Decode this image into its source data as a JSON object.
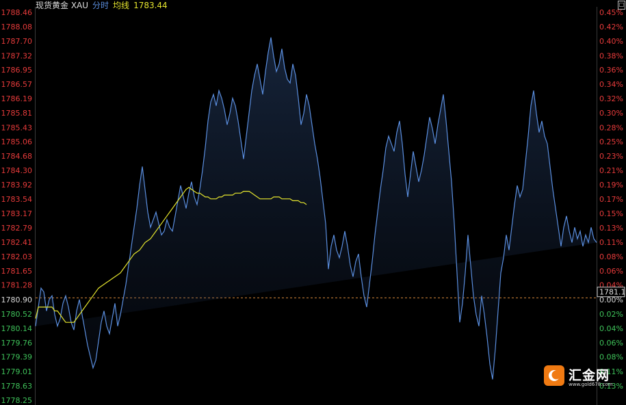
{
  "header": {
    "instrument": "现货黄金 XAU",
    "mode": "分时",
    "avg_label": "均线",
    "avg_value": "1783.44"
  },
  "corner_glyph": "□",
  "colors": {
    "background": "#000000",
    "price_line": "#5b8fe0",
    "average_line": "#e6e62e",
    "up_text": "#e83b3b",
    "down_text": "#3fc35a",
    "neutral_text": "#dddddd",
    "reference_line": "#d98a3c"
  },
  "logo": {
    "icon": "crescent-logo-icon",
    "name": "汇金网",
    "url_text": "www.gold678.com"
  },
  "chart_data": {
    "type": "line",
    "reference_price": 1780.9,
    "current_price_label": "1781.1",
    "ylim": [
      1778.25,
      1788.46
    ],
    "y_ticks": [
      "1788.46",
      "1788.08",
      "1787.70",
      "1787.32",
      "1786.95",
      "1786.57",
      "1786.19",
      "1785.81",
      "1785.43",
      "1785.06",
      "1784.68",
      "1784.30",
      "1783.92",
      "1783.54",
      "1783.17",
      "1782.79",
      "1782.41",
      "1782.03",
      "1781.65",
      "1781.28",
      "1780.90",
      "1780.52",
      "1780.14",
      "1779.76",
      "1779.39",
      "1779.01",
      "1778.63",
      "1778.25"
    ],
    "y2_ticks": [
      "0.45%",
      "0.42%",
      "0.40%",
      "0.38%",
      "0.36%",
      "0.34%",
      "0.32%",
      "0.30%",
      "0.28%",
      "0.25%",
      "0.23%",
      "0.21%",
      "0.19%",
      "0.17%",
      "0.15%",
      "0.13%",
      "0.11%",
      "0.08%",
      "0.06%",
      "0.04%",
      "0.00%",
      "0.02%",
      "0.04%",
      "0.06%",
      "0.08%",
      "0.11%",
      "0.13%"
    ],
    "x": [
      0,
      2,
      4,
      6,
      8,
      10,
      12,
      14,
      16,
      18,
      20,
      22,
      24,
      26,
      28,
      30,
      32,
      34,
      36,
      38,
      40,
      42,
      44,
      46,
      48,
      50,
      52,
      54,
      56,
      58,
      60,
      62,
      64,
      66,
      68,
      70,
      72,
      74,
      76,
      78,
      80,
      82,
      84,
      86,
      88,
      90,
      92,
      94,
      96,
      98,
      100,
      102,
      104,
      106,
      108,
      110,
      112,
      114,
      116,
      118,
      120,
      122,
      124,
      126,
      128,
      130,
      132,
      134,
      136,
      138,
      140,
      142,
      144,
      146,
      148,
      150,
      152,
      154,
      156,
      158,
      160,
      162,
      164,
      166,
      168,
      170,
      172,
      174,
      176,
      178,
      180,
      182,
      184,
      186,
      188,
      190,
      192,
      194,
      196,
      198,
      200,
      202,
      204,
      206,
      208,
      210,
      212,
      214,
      216,
      218,
      220,
      222,
      224,
      226,
      228,
      230,
      232,
      234,
      236,
      238,
      240,
      242,
      244,
      246,
      248,
      250,
      252,
      254,
      256,
      258,
      260,
      262,
      264,
      266,
      268,
      270,
      272,
      274,
      276,
      278,
      280,
      282,
      284,
      286,
      288,
      290,
      292,
      294,
      296,
      298,
      300,
      302,
      304,
      306,
      308,
      310,
      312,
      314,
      316,
      318,
      320,
      322,
      324,
      326,
      328,
      330,
      332,
      334,
      336,
      338,
      340,
      342,
      344,
      346,
      348,
      350,
      352,
      354,
      356,
      358,
      360,
      362,
      364,
      366,
      368,
      370,
      372,
      374,
      376,
      378,
      380,
      382,
      384,
      386,
      388,
      390,
      392,
      394,
      396,
      398,
      400,
      402,
      404,
      406,
      408,
      410
    ],
    "series": [
      {
        "values": [
          1780.2,
          1780.7,
          1781.2,
          1781.1,
          1780.6,
          1780.9,
          1781.0,
          1780.5,
          1780.2,
          1780.4,
          1780.8,
          1781.0,
          1780.7,
          1780.3,
          1780.1,
          1780.6,
          1780.9,
          1780.5,
          1780.1,
          1779.7,
          1779.4,
          1779.1,
          1779.3,
          1779.8,
          1780.3,
          1780.6,
          1780.2,
          1780.0,
          1780.4,
          1780.8,
          1780.2,
          1780.5,
          1780.9,
          1781.3,
          1781.8,
          1782.3,
          1782.8,
          1783.3,
          1783.9,
          1784.4,
          1783.8,
          1783.2,
          1782.8,
          1783.0,
          1783.2,
          1782.9,
          1782.6,
          1782.7,
          1783.0,
          1782.8,
          1782.7,
          1783.1,
          1783.5,
          1783.9,
          1783.6,
          1783.3,
          1783.7,
          1784.0,
          1783.6,
          1783.4,
          1783.8,
          1784.3,
          1784.9,
          1785.6,
          1786.1,
          1786.3,
          1786.0,
          1786.4,
          1786.2,
          1785.9,
          1785.5,
          1785.8,
          1786.2,
          1786.0,
          1785.6,
          1785.1,
          1784.6,
          1785.2,
          1785.8,
          1786.4,
          1786.8,
          1787.1,
          1786.7,
          1786.3,
          1786.9,
          1787.4,
          1787.8,
          1787.3,
          1786.9,
          1787.1,
          1787.5,
          1787.0,
          1786.7,
          1786.6,
          1787.1,
          1786.8,
          1786.2,
          1785.5,
          1785.8,
          1786.3,
          1786.0,
          1785.5,
          1785.0,
          1784.6,
          1784.1,
          1783.5,
          1782.9,
          1781.7,
          1782.3,
          1782.6,
          1782.2,
          1782.0,
          1782.3,
          1782.7,
          1782.3,
          1781.8,
          1781.5,
          1781.9,
          1782.1,
          1781.5,
          1781.0,
          1780.7,
          1781.3,
          1781.9,
          1782.6,
          1783.2,
          1783.8,
          1784.3,
          1784.9,
          1785.2,
          1785.0,
          1784.8,
          1785.3,
          1785.6,
          1785.0,
          1784.2,
          1783.6,
          1784.2,
          1784.8,
          1784.4,
          1784.0,
          1784.3,
          1784.7,
          1785.2,
          1785.7,
          1785.4,
          1785.0,
          1785.5,
          1785.9,
          1786.3,
          1785.6,
          1784.8,
          1784.0,
          1782.9,
          1781.6,
          1780.3,
          1780.8,
          1781.6,
          1782.6,
          1781.8,
          1781.0,
          1780.5,
          1780.2,
          1781.0,
          1780.5,
          1779.9,
          1779.2,
          1778.8,
          1779.6,
          1780.6,
          1781.6,
          1782.0,
          1782.6,
          1782.2,
          1782.8,
          1783.4,
          1783.9,
          1783.6,
          1783.8,
          1784.5,
          1785.2,
          1786.0,
          1786.4,
          1785.8,
          1785.3,
          1785.6,
          1785.2,
          1785.0,
          1784.4,
          1783.8,
          1783.3,
          1782.8,
          1782.3,
          1782.8,
          1783.1,
          1782.7,
          1782.4,
          1782.8,
          1782.5,
          1782.7,
          1782.3,
          1782.6,
          1782.4,
          1782.8,
          1782.5,
          1782.4,
          1782.3,
          1782.1,
          1781.8,
          1781.6,
          1781.4,
          1781.1,
          1780.9,
          1781.1
        ]
      },
      {
        "values": [
          1780.4,
          1780.7,
          1780.7,
          1780.7,
          1780.7,
          1780.7,
          1780.7,
          1780.6,
          1780.6,
          1780.5,
          1780.4,
          1780.3,
          1780.3,
          1780.3,
          1780.3,
          1780.4,
          1780.5,
          1780.6,
          1780.7,
          1780.8,
          1780.9,
          1781.0,
          1781.1,
          1781.2,
          1781.25,
          1781.3,
          1781.35,
          1781.4,
          1781.45,
          1781.5,
          1781.55,
          1781.6,
          1781.7,
          1781.8,
          1781.9,
          1782.0,
          1782.1,
          1782.15,
          1782.2,
          1782.3,
          1782.4,
          1782.45,
          1782.5,
          1782.6,
          1782.7,
          1782.8,
          1782.9,
          1783.0,
          1783.1,
          1783.2,
          1783.3,
          1783.4,
          1783.5,
          1783.6,
          1783.7,
          1783.8,
          1783.85,
          1783.8,
          1783.75,
          1783.7,
          1783.7,
          1783.65,
          1783.6,
          1783.6,
          1783.55,
          1783.55,
          1783.55,
          1783.6,
          1783.6,
          1783.65,
          1783.65,
          1783.65,
          1783.65,
          1783.7,
          1783.7,
          1783.7,
          1783.75,
          1783.75,
          1783.75,
          1783.7,
          1783.65,
          1783.6,
          1783.55,
          1783.55,
          1783.55,
          1783.55,
          1783.55,
          1783.6,
          1783.6,
          1783.6,
          1783.55,
          1783.55,
          1783.55,
          1783.55,
          1783.5,
          1783.5,
          1783.5,
          1783.45,
          1783.45,
          1783.4
        ]
      }
    ]
  }
}
